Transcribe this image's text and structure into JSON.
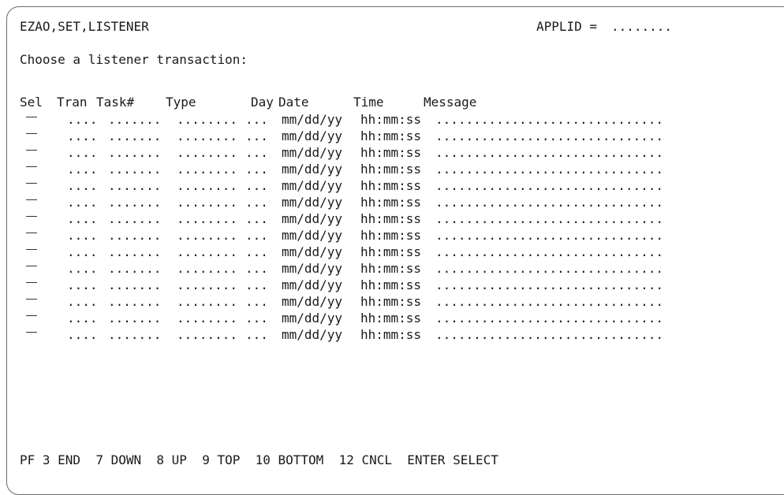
{
  "panel": {
    "title": "EZAO,SET,LISTENER",
    "applid_label": "APPLID = ",
    "applid_value": "........",
    "prompt": "Choose a listener transaction:"
  },
  "table": {
    "headers": {
      "sel": "Sel",
      "tran": "Tran",
      "task": "Task#",
      "type": "Type",
      "day": "Day",
      "date": "Date",
      "time": "Time",
      "message": "Message"
    },
    "rows": [
      {
        "tran": "....",
        "task": ".......",
        "type": "........",
        "day": "...",
        "date": "mm/dd/yy",
        "time": "hh:mm:ss",
        "message": ".............................."
      },
      {
        "tran": "....",
        "task": ".......",
        "type": "........",
        "day": "...",
        "date": "mm/dd/yy",
        "time": "hh:mm:ss",
        "message": ".............................."
      },
      {
        "tran": "....",
        "task": ".......",
        "type": "........",
        "day": "...",
        "date": "mm/dd/yy",
        "time": "hh:mm:ss",
        "message": ".............................."
      },
      {
        "tran": "....",
        "task": ".......",
        "type": "........",
        "day": "...",
        "date": "mm/dd/yy",
        "time": "hh:mm:ss",
        "message": ".............................."
      },
      {
        "tran": "....",
        "task": ".......",
        "type": "........",
        "day": "...",
        "date": "mm/dd/yy",
        "time": "hh:mm:ss",
        "message": ".............................."
      },
      {
        "tran": "....",
        "task": ".......",
        "type": "........",
        "day": "...",
        "date": "mm/dd/yy",
        "time": "hh:mm:ss",
        "message": ".............................."
      },
      {
        "tran": "....",
        "task": ".......",
        "type": "........",
        "day": "...",
        "date": "mm/dd/yy",
        "time": "hh:mm:ss",
        "message": ".............................."
      },
      {
        "tran": "....",
        "task": ".......",
        "type": "........",
        "day": "...",
        "date": "mm/dd/yy",
        "time": "hh:mm:ss",
        "message": ".............................."
      },
      {
        "tran": "....",
        "task": ".......",
        "type": "........",
        "day": "...",
        "date": "mm/dd/yy",
        "time": "hh:mm:ss",
        "message": ".............................."
      },
      {
        "tran": "....",
        "task": ".......",
        "type": "........",
        "day": "...",
        "date": "mm/dd/yy",
        "time": "hh:mm:ss",
        "message": ".............................."
      },
      {
        "tran": "....",
        "task": ".......",
        "type": "........",
        "day": "...",
        "date": "mm/dd/yy",
        "time": "hh:mm:ss",
        "message": ".............................."
      },
      {
        "tran": "....",
        "task": ".......",
        "type": "........",
        "day": "...",
        "date": "mm/dd/yy",
        "time": "hh:mm:ss",
        "message": ".............................."
      },
      {
        "tran": "....",
        "task": ".......",
        "type": "........",
        "day": "...",
        "date": "mm/dd/yy",
        "time": "hh:mm:ss",
        "message": ".............................."
      },
      {
        "tran": "....",
        "task": ".......",
        "type": "........",
        "day": "...",
        "date": "mm/dd/yy",
        "time": "hh:mm:ss",
        "message": ".............................."
      }
    ]
  },
  "pf_keys": "PF 3 END  7 DOWN  8 UP  9 TOP  10 BOTTOM  12 CNCL  ENTER SELECT"
}
